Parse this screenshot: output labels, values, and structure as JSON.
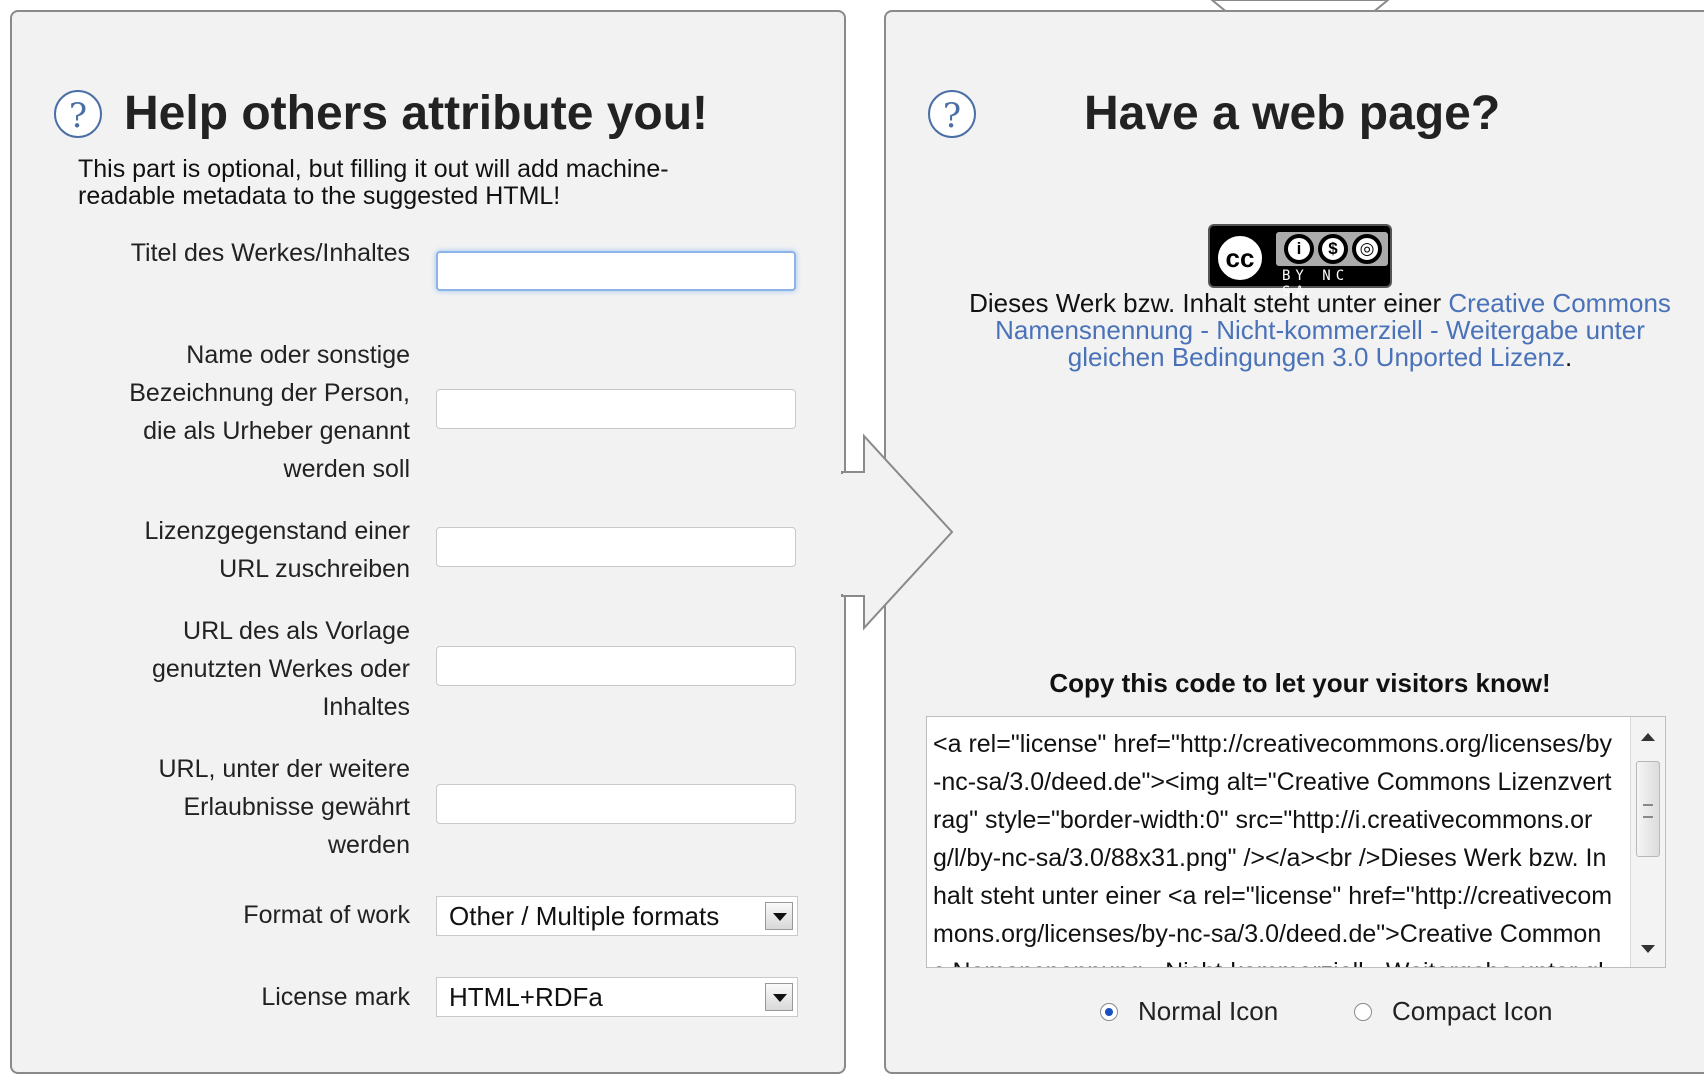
{
  "left": {
    "title": "Help others attribute you!",
    "intro": "This part is optional, but filling it out will add machine-readable metadata to the suggested HTML!",
    "help_icon": "question-icon",
    "fields": [
      {
        "label": "Titel des Werkes/Inhaltes",
        "value": ""
      },
      {
        "label": "Name oder sonstige Bezeichnung der Person, die als Urheber genannt werden soll",
        "value": ""
      },
      {
        "label": "Lizenzgegenstand einer URL zuschreiben",
        "value": ""
      },
      {
        "label": "URL des als Vorlage genutzten Werkes oder Inhaltes",
        "value": ""
      },
      {
        "label": "URL, unter der weitere Erlaubnisse gewährt werden",
        "value": ""
      }
    ],
    "format_label": "Format of work",
    "format_value": "Other / Multiple formats",
    "license_mark_label": "License mark",
    "license_mark_value": "HTML+RDFa"
  },
  "right": {
    "title": "Have a web page?",
    "help_icon": "question-icon",
    "badge": {
      "main": "cc",
      "bottom_text": "BY NC SA",
      "icons": [
        "by-icon",
        "nc-icon",
        "sa-icon"
      ]
    },
    "license_prefix": "Dieses Werk bzw. Inhalt steht unter einer ",
    "license_link": "Creative Commons Namensnennung - Nicht-kommerziell - Weitergabe unter gleichen Bedingungen 3.0 Unported Lizenz",
    "license_suffix": ".",
    "copy_title": "Copy this code to let your visitors know!",
    "code": "<a rel=\"license\" href=\"http://creativecommons.org/licenses/by-nc-sa/3.0/deed.de\"><img alt=\"Creative Commons Lizenzvertrag\" style=\"border-width:0\" src=\"http://i.creativecommons.org/l/by-nc-sa/3.0/88x31.png\" /></a><br />Dieses Werk bzw. Inhalt steht unter einer <a rel=\"license\" href=\"http://creativecommons.org/licenses/by-nc-sa/3.0/deed.de\">Creative Commons Namensnennung - Nicht-kommerziell - Weitergabe unter gleichen Bedingungen 3.0 Unported Lizenz</a>.",
    "radio_normal": "Normal Icon",
    "radio_compact": "Compact Icon",
    "selected_icon": "Normal Icon"
  },
  "colors": {
    "panel_bg": "#f2f2f2",
    "link": "#4a72b8",
    "focus": "#8cb4e6"
  }
}
